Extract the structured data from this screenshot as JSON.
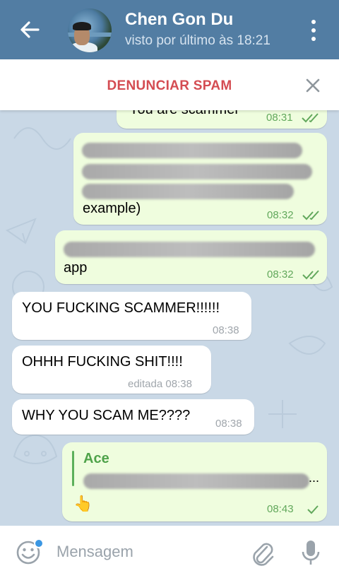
{
  "header": {
    "title": "Chen Gon Du",
    "status": "visto por último às 18:21",
    "icons": [
      "back-arrow-icon",
      "avatar",
      "more-vert-icon"
    ]
  },
  "spam_bar": {
    "label": "DENUNCIAR SPAM",
    "close_icon": "close-icon"
  },
  "messages": [
    {
      "side": "out",
      "text": "You are scammer",
      "time": "08:31",
      "status": "read"
    },
    {
      "side": "out",
      "text": "example)",
      "time": "08:32",
      "status": "read",
      "redacted": true
    },
    {
      "side": "out",
      "text": "app",
      "time": "08:32",
      "status": "read",
      "redacted": true
    },
    {
      "side": "in",
      "text": "YOU FUCKING SCAMMER!!!!!!",
      "time": "08:38"
    },
    {
      "side": "in",
      "text": "OHHH FUCKING SHIT!!!!",
      "time": "editada 08:38"
    },
    {
      "side": "in",
      "text": "WHY YOU SCAM ME????",
      "time": "08:38"
    },
    {
      "side": "out",
      "reply_name": "Ace",
      "reply_tail": "...",
      "text": "👆",
      "time": "08:43",
      "status": "sent",
      "redacted": true
    }
  ],
  "input": {
    "placeholder": "Mensagem",
    "icons": [
      "emoji-icon",
      "attach-icon",
      "mic-icon"
    ]
  },
  "colors": {
    "header": "#527da3",
    "spam_text": "#d44c52",
    "outgoing_bubble": "#effdde",
    "incoming_bubble": "#ffffff",
    "outgoing_time": "#62a85c",
    "chat_background": "#c9d8e6"
  }
}
